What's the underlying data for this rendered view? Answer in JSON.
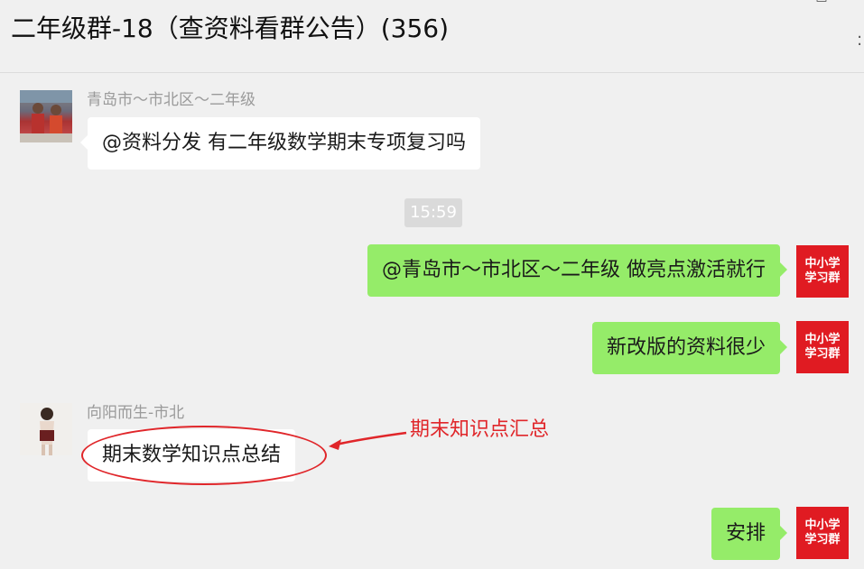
{
  "header": {
    "title": "二年级群-18（查资料看群公告）(356)",
    "controls": {
      "pin": "⊥",
      "minimize": "—",
      "maximize": "□"
    }
  },
  "avatars": {
    "brand_line1": "中小学",
    "brand_line2": "学习群"
  },
  "messages": [
    {
      "sender": "青岛市～市北区～二年级",
      "text": "@资料分发 有二年级数学期末专项复习吗",
      "direction": "in"
    },
    {
      "text": "@青岛市～市北区～二年级 做亮点激活就行",
      "direction": "out"
    },
    {
      "text": "新改版的资料很少",
      "direction": "out"
    },
    {
      "sender": "向阳而生-市北",
      "text": "期末数学知识点总结",
      "direction": "in"
    },
    {
      "text": "安排",
      "direction": "out"
    }
  ],
  "timestamp": "15:59",
  "annotation": {
    "text": "期末知识点汇总",
    "color": "#e0262a"
  },
  "colors": {
    "outgoing_bubble": "#95ec69",
    "incoming_bubble": "#ffffff",
    "background": "#f0f0f0"
  }
}
